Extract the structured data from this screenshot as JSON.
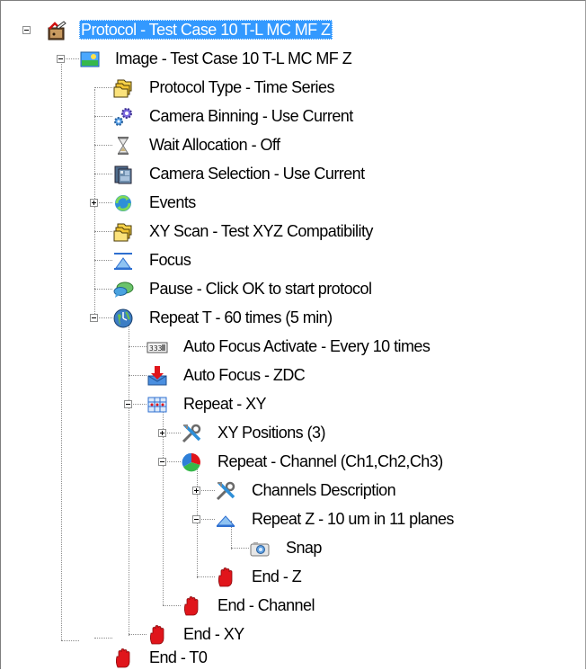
{
  "colors": {
    "selection": "#3399ff",
    "stop": "#e0151b",
    "tree_line": "#8c8c8c"
  },
  "tree": {
    "protocol": {
      "label": "Protocol - Test Case 10 T-L MC MF Z",
      "icon": "protocol-icon",
      "expanded": true,
      "selected": true
    },
    "image": {
      "label": "Image - Test Case 10 T-L MC MF Z",
      "icon": "image-icon",
      "expanded": true
    },
    "protocol_type": {
      "label": "Protocol Type - Time Series",
      "icon": "folders-icon"
    },
    "camera_binning": {
      "label": "Camera Binning - Use Current",
      "icon": "gears-icon"
    },
    "wait_allocation": {
      "label": "Wait Allocation - Off",
      "icon": "hourglass-icon"
    },
    "camera_selection": {
      "label": "Camera Selection - Use Current",
      "icon": "film-icon"
    },
    "events": {
      "label": "Events",
      "icon": "refresh-icon",
      "expanded": false
    },
    "xy_scan": {
      "label": "XY Scan - Test XYZ Compatibility",
      "icon": "folders-icon"
    },
    "focus": {
      "label": "Focus",
      "icon": "focus-icon"
    },
    "pause": {
      "label": "Pause - Click OK to start protocol",
      "icon": "speech-bubble-icon"
    },
    "repeat_t": {
      "label": "Repeat T - 60 times (5 min)",
      "icon": "clock-globe-icon",
      "expanded": true
    },
    "auto_focus_activate": {
      "label": "Auto Focus Activate - Every 10 times",
      "icon": "counter-icon"
    },
    "auto_focus_zdc": {
      "label": "Auto Focus - ZDC",
      "icon": "download-arrow-icon"
    },
    "repeat_xy": {
      "label": "Repeat - XY",
      "icon": "grid-icon",
      "expanded": true
    },
    "xy_positions": {
      "label": "XY Positions (3)",
      "icon": "tools-icon",
      "expanded": false
    },
    "repeat_channel": {
      "label": "Repeat - Channel (Ch1,Ch2,Ch3)",
      "icon": "pie-icon",
      "expanded": true
    },
    "channels_description": {
      "label": "Channels Description",
      "icon": "tools-icon",
      "expanded": false
    },
    "repeat_z": {
      "label": "Repeat Z - 10 um in 11 planes",
      "icon": "focus-icon",
      "expanded": true
    },
    "snap": {
      "label": "Snap",
      "icon": "camera-icon"
    },
    "end_z": {
      "label": "End - Z",
      "icon": "stop-hand-icon"
    },
    "end_channel": {
      "label": "End - Channel",
      "icon": "stop-hand-icon"
    },
    "end_xy": {
      "label": "End - XY",
      "icon": "stop-hand-icon"
    },
    "end_t0": {
      "label": "End - T0",
      "icon": "stop-hand-icon"
    }
  }
}
